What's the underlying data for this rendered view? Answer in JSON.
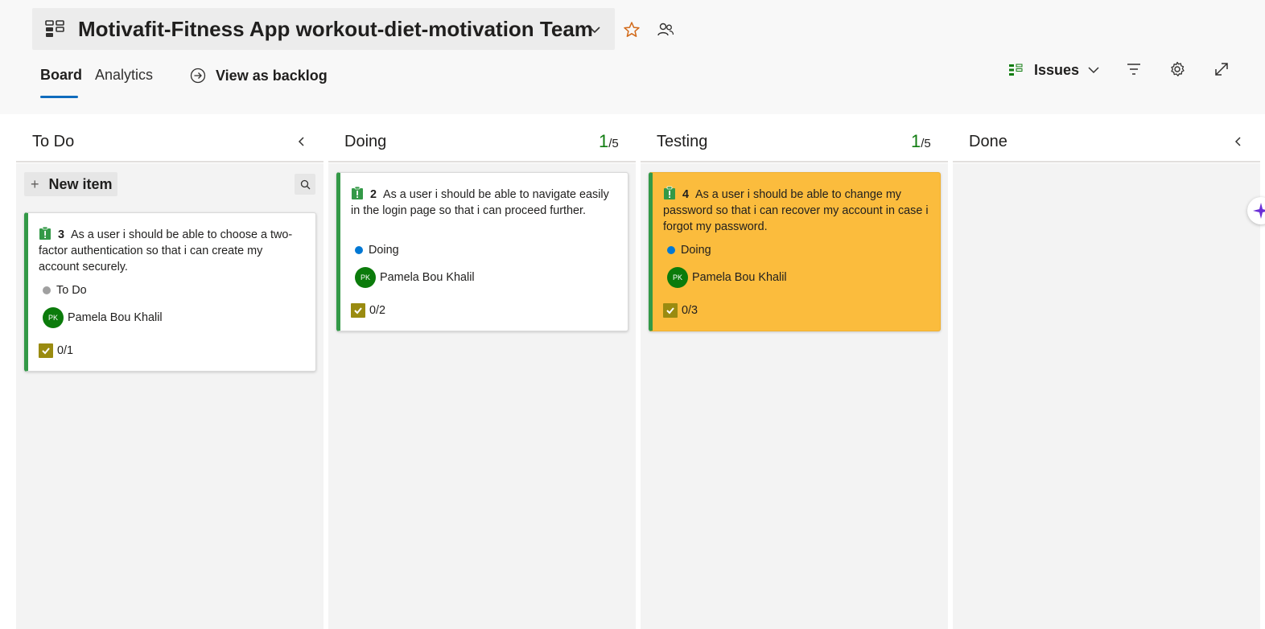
{
  "header": {
    "team_name": "Motivafit-Fitness App workout-diet-motivation Team",
    "tabs": [
      {
        "label": "Board",
        "selected": true
      },
      {
        "label": "Analytics",
        "selected": false
      }
    ],
    "view_as_backlog_label": "View as backlog",
    "backlog_level_label": "Issues",
    "icons": [
      "board-team-icon",
      "chevron-down-icon",
      "favorite-star-icon",
      "team-members-icon",
      "arrow-circle-icon",
      "filter-icon",
      "settings-gear-icon",
      "fullscreen-expand-icon"
    ]
  },
  "board": {
    "new_item_label": "New item",
    "columns": [
      {
        "title": "To Do",
        "wip_current": "",
        "wip_limit": ""
      },
      {
        "title": "Doing",
        "wip_current": "1",
        "wip_limit": "/5"
      },
      {
        "title": "Testing",
        "wip_current": "1",
        "wip_limit": "/5"
      },
      {
        "title": "Done",
        "wip_current": "",
        "wip_limit": ""
      }
    ],
    "cards": [
      {
        "id": "3",
        "title": "As a user i should be able to choose a two-factor authentication so that i can create my account securely.",
        "state": "To Do",
        "state_color": "#a0a0a0",
        "assignee_initials": "PK",
        "assignee": "Pamela Bou Khalil",
        "tasks": "0/1",
        "highlighted": false
      },
      {
        "id": "2",
        "title": "As a user i should be able to navigate easily in the login page so that i can proceed further.",
        "state": "Doing",
        "state_color": "#0078d4",
        "assignee_initials": "PK",
        "assignee": "Pamela Bou Khalil",
        "tasks": "0/2",
        "highlighted": false
      },
      {
        "id": "4",
        "title": "As a user i should be able to change my password so that i can recover my account in case i forgot my password.",
        "state": "Doing",
        "state_color": "#0078d4",
        "assignee_initials": "PK",
        "assignee": "Pamela Bou Khalil",
        "tasks": "0/3",
        "highlighted": true
      }
    ]
  },
  "colors": {
    "accent": "#0f6cbd",
    "card_border_green": "#339947",
    "highlight_card": "#fbbc3d",
    "avatar_green": "#0b7b0b",
    "task_check": "#9a8b10",
    "wip_green": "#107c10"
  }
}
